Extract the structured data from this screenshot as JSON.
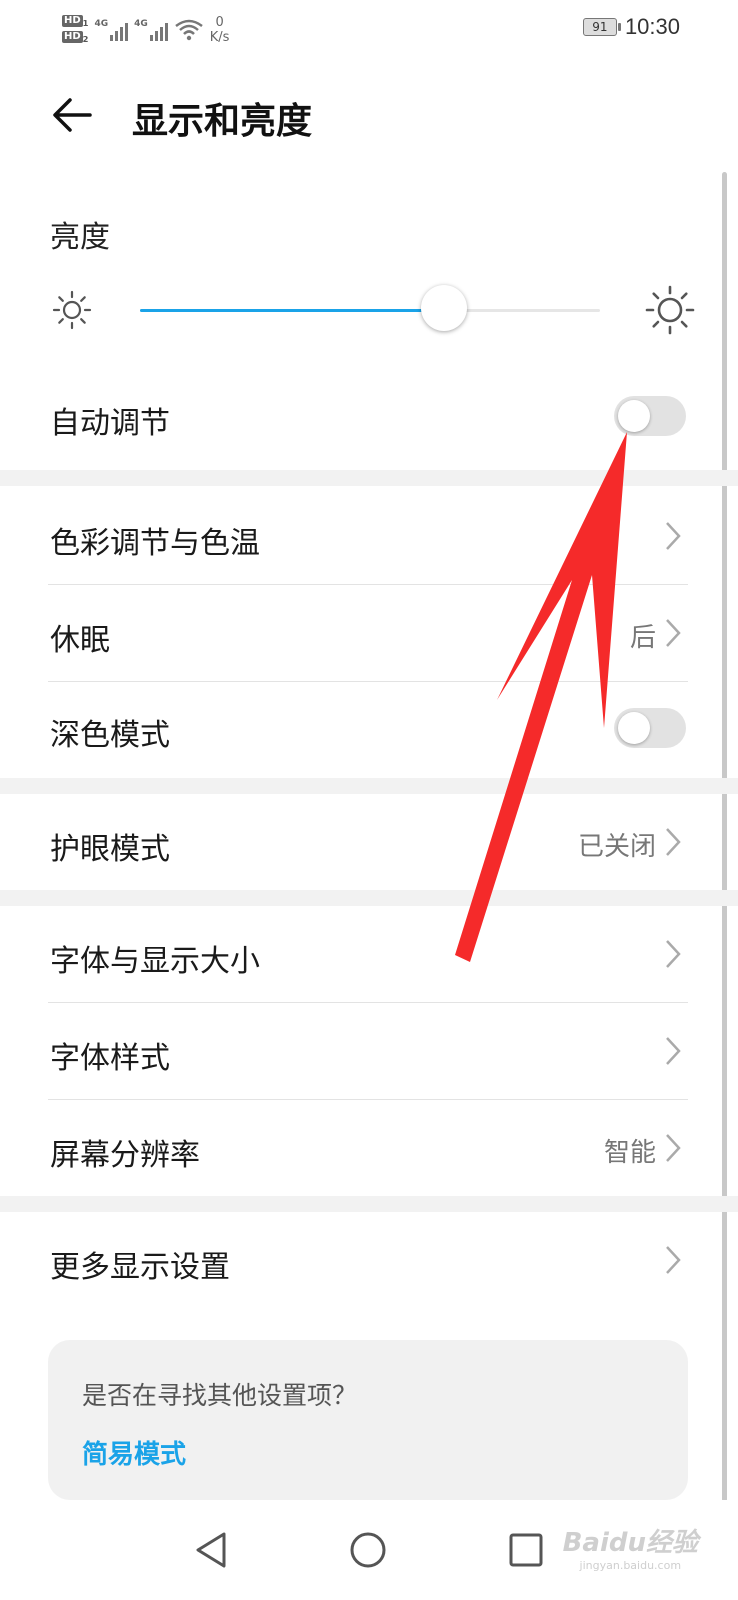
{
  "status_bar": {
    "hd1": "HD",
    "hd1_sub": "1",
    "hd2": "HD",
    "hd2_sub": "2",
    "net1": "4G",
    "net2": "4G",
    "speed_value": "0",
    "speed_unit": "K/s",
    "battery": "91",
    "time": "10:30"
  },
  "header": {
    "title": "显示和亮度",
    "back_icon": "back-arrow-icon"
  },
  "brightness": {
    "label": "亮度",
    "level": 0.66,
    "accent_color": "#1aa3e8"
  },
  "rows": {
    "auto_adjust": {
      "label": "自动调节",
      "toggle": false
    },
    "color_temp": {
      "label": "色彩调节与色温"
    },
    "sleep": {
      "label": "休眠",
      "value": "后"
    },
    "dark_mode": {
      "label": "深色模式",
      "toggle": false
    },
    "eye_comfort": {
      "label": "护眼模式",
      "value": "已关闭"
    },
    "font_display_size": {
      "label": "字体与显示大小"
    },
    "font_style": {
      "label": "字体样式"
    },
    "resolution": {
      "label": "屏幕分辨率",
      "value": "智能"
    },
    "more_display": {
      "label": "更多显示设置"
    }
  },
  "suggestion_card": {
    "question": "是否在寻找其他设置项？",
    "link": "简易模式"
  },
  "nav_bar": {
    "back_icon": "nav-back-icon",
    "home_icon": "nav-home-icon",
    "recents_icon": "nav-recents-icon"
  },
  "watermark": {
    "brand": "Baidu经验",
    "url": "jingyan.baidu.com"
  },
  "annotation_color": "#f52a2a"
}
